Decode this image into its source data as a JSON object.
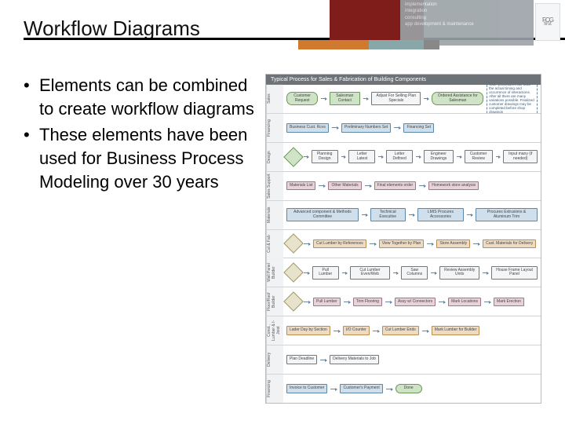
{
  "header": {
    "title": "Workflow Diagrams",
    "logo_text": "FCG",
    "logo_sub": "first",
    "grey_lines": [
      "implementation",
      "integration",
      "consulting",
      "app development & maintenance"
    ]
  },
  "bullets": [
    "Elements can be combined to create workflow diagrams",
    "These elements have been used for Business Process Modeling over 30 years"
  ],
  "diagram": {
    "title": "Typical Process for Sales & Fabrication of Building Components",
    "note": "Note: procedures will track the actual timing and occurrence of interactions. After all there are many variations possible. Finalized customer drawings may be completed before shop drawings",
    "lanes": [
      {
        "label": "Sales",
        "nodes": [
          "Customer Request",
          "Salesman Contact",
          "Adjust For Selling Plan Specials",
          "Ordered Assistance for Salesman"
        ]
      },
      {
        "label": "Financing",
        "nodes": [
          "Business Cust. Rcvs",
          "Preliminary Numbers Set",
          "Financing Set"
        ]
      },
      {
        "label": "Design",
        "nodes": [
          "Planning Design",
          "Letter Latest",
          "Letter Defined",
          "Engineer Drawings",
          "Customer Review",
          "Input many (if needed)"
        ]
      },
      {
        "label": "Sales Support",
        "nodes": [
          "Materials List",
          "Other Materials",
          "Final elements order",
          "Homework store analysis"
        ]
      },
      {
        "label": "Materials",
        "nodes": [
          "Advanced component & Methods Committee",
          "Technical Executive",
          "LMIS Procures Accessories",
          "Procures Extrusions & Aluminum Trim"
        ]
      },
      {
        "label": "Cut & Fab",
        "nodes": [
          "Cut Lumber by References",
          "View Together by Plan",
          "Store Assembly",
          "Cust. Materials for Delivery"
        ]
      },
      {
        "label": "Wall Panel Builder",
        "nodes": [
          "Pull Lumber",
          "Cut Lumber Even/Web",
          "Saw Columns",
          "Review Assembly Units",
          "House Frame Layout Panel"
        ]
      },
      {
        "label": "Floor/Roof Builder",
        "nodes": [
          "Pull Lumber",
          "Trim Flooring",
          "Assy w/ Connectors",
          "Mark Locations",
          "Mark Erection"
        ]
      },
      {
        "label": "Const., Lumber & I-Joist",
        "nodes": [
          "Lader Day by Section",
          "I/O Counter",
          "Cut Lumber Ends",
          "Mark Lumber for Builder"
        ]
      },
      {
        "label": "Delivery",
        "nodes": [
          "Plan Deadline",
          "Delivery Materials to Job"
        ]
      },
      {
        "label": "Financing",
        "nodes": [
          "Invoice to Customer",
          "Customer's Payment",
          "Done"
        ]
      }
    ]
  }
}
